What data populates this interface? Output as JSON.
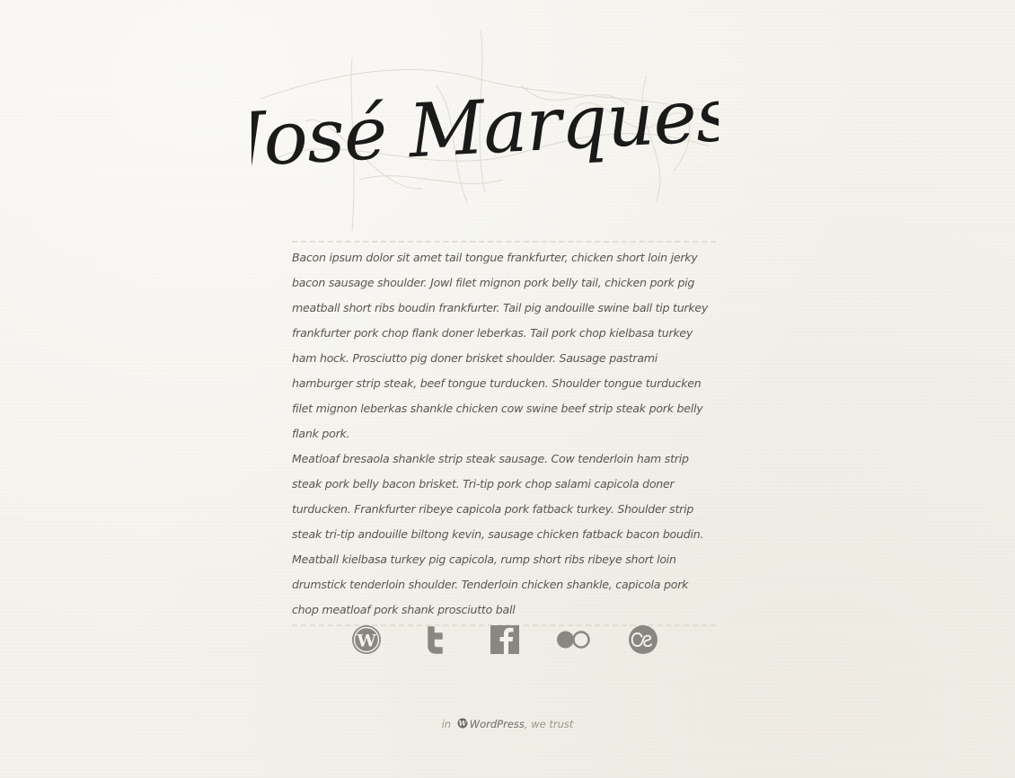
{
  "site": {
    "title": "José Marques"
  },
  "content": {
    "paragraphs": [
      "Bacon ipsum dolor sit amet tail tongue frankfurter, chicken short loin jerky bacon sausage shoulder. Jowl filet mignon pork belly tail, chicken pork pig meatball short ribs boudin frankfurter. Tail pig andouille swine ball tip turkey frankfurter pork chop flank doner leberkas. Tail pork chop kielbasa turkey ham hock. Prosciutto pig doner brisket shoulder. Sausage pastrami hamburger strip steak, beef tongue turducken. Shoulder tongue turducken filet mignon leberkas shankle chicken cow swine beef strip steak pork belly flank pork.",
      "Meatloaf bresaola shankle strip steak sausage. Cow tenderloin ham strip steak pork belly bacon brisket. Tri-tip pork chop salami capicola doner turducken. Frankfurter ribeye capicola pork fatback turkey. Shoulder strip steak tri-tip andouille biltong kevin, sausage chicken fatback bacon boudin. Meatball kielbasa turkey pig capicola, rump short ribs ribeye short loin drumstick tenderloin shoulder. Tenderloin chicken shankle, capicola pork chop meatloaf pork shank prosciutto ball"
    ]
  },
  "social": [
    {
      "name": "wordpress",
      "icon": "wordpress-icon"
    },
    {
      "name": "twitter",
      "icon": "twitter-icon"
    },
    {
      "name": "facebook",
      "icon": "facebook-icon"
    },
    {
      "name": "flickr",
      "icon": "flickr-icon"
    },
    {
      "name": "lastfm",
      "icon": "lastfm-icon"
    }
  ],
  "footer": {
    "prefix": "in",
    "link_label": "WordPress",
    "suffix": ", we trust"
  },
  "colors": {
    "background": "#f4f2ec",
    "text": "#5a5650",
    "icon": "#8a8783",
    "title_ink": "#1a1a1a"
  }
}
